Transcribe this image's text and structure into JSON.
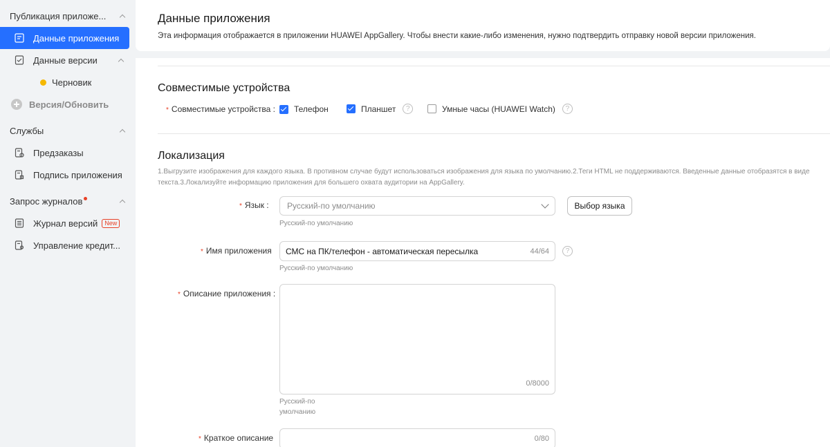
{
  "sidebar": {
    "group1": {
      "title": "Публикация приложе..."
    },
    "items1": [
      {
        "label": "Данные приложения"
      },
      {
        "label": "Данные версии"
      }
    ],
    "draft": {
      "label": "Черновик"
    },
    "version_update": {
      "label": "Версия/Обновить"
    },
    "group2": {
      "title": "Службы"
    },
    "items2": [
      {
        "label": "Предзаказы"
      },
      {
        "label": "Подпись приложения"
      }
    ],
    "group3": {
      "title": "Запрос журналов"
    },
    "items3": [
      {
        "label": "Журнал версий",
        "badge": "New"
      },
      {
        "label": "Управление кредит..."
      }
    ]
  },
  "header": {
    "title": "Данные приложения",
    "description": "Эта информация отображается в приложении HUAWEI AppGallery. Чтобы внести какие-либо изменения, нужно подтвердить отправку новой версии приложения."
  },
  "compat": {
    "title": "Совместимые устройства",
    "label": "Совместимые устройства :",
    "phone": "Телефон",
    "tablet": "Планшет",
    "watch": "Умные часы (HUAWEI Watch)",
    "help": "?"
  },
  "localization": {
    "title": "Локализация",
    "hint": "1.Выгрузите изображения для каждого языка. В противном случае будут использоваться изображения для языка по умолчанию.2.Теги HTML не поддерживаются. Введенные данные отобразятся в виде текста.3.Локализуйте информацию приложения для большего охвата аудитории на AppGallery.",
    "language_label": "Язык :",
    "language_value": "Русский-по умолчанию",
    "language_below": "Русский-по умолчанию",
    "choose_language": "Выбор языка",
    "app_name_label": "Имя приложения",
    "app_name_value": "СМС на ПК/телефон - автоматическая пересылка",
    "app_name_count": "44/64",
    "app_name_below": "Русский-по умолчанию",
    "description_label": "Описание приложения :",
    "description_count": "0/8000",
    "description_below": "Русский-по умолчанию",
    "short_label": "Краткое описание",
    "short_count": "0/80"
  },
  "colors": {
    "accent": "#256fff",
    "required": "#e84026",
    "draft": "#f5b800"
  }
}
